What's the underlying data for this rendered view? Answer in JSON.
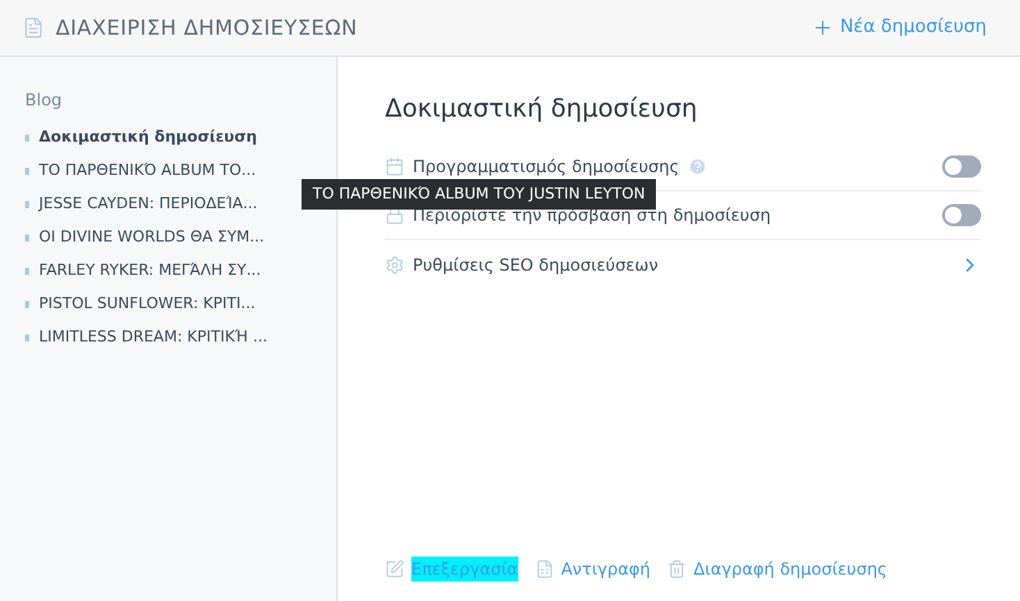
{
  "header": {
    "title": "ΔΙΑΧΕΙΡΙΣΗ ΔΗΜΟΣΙΕΥΣΕΩΝ",
    "new_button": "Νέα δημοσίευση"
  },
  "sidebar": {
    "heading": "Blog",
    "items": [
      {
        "label": "Δοκιμαστική δημοσίευση",
        "selected": true
      },
      {
        "label": "ΤΟ ΠΑΡΘΕΝΙΚΌ ALBUM ΤΟ...",
        "selected": false
      },
      {
        "label": "JESSE CAYDEN: ΠΕΡΙΟΔΕΊΑ...",
        "selected": false
      },
      {
        "label": "OI DIVINE WORLDS ΘΑ ΣΥΜ...",
        "selected": false
      },
      {
        "label": "FARLEY RYKER: ΜΕΓΆΛΗ ΣΥ...",
        "selected": false
      },
      {
        "label": "PISTOL SUNFLOWER: ΚΡΙΤΙ...",
        "selected": false
      },
      {
        "label": "LIMITLESS DREAM: ΚΡΙΤΙΚΉ ...",
        "selected": false
      }
    ]
  },
  "tooltip": "ΤΟ ΠΑΡΘΕΝΙΚΌ ALBUM ΤΟΥ JUSTIN LEYTON",
  "main": {
    "title": "Δοκιμαστική δημοσίευση",
    "settings": [
      {
        "kind": "toggle",
        "label": "Προγραμματισμός δημοσίευσης",
        "help": true,
        "on": false
      },
      {
        "kind": "toggle",
        "label": "Περιορίστε την πρόσβαση στη δημοσίευση",
        "help": false,
        "on": false
      },
      {
        "kind": "link",
        "label": "Ρυθμίσεις SEO δημοσιεύσεων"
      }
    ],
    "actions": [
      {
        "label": "Επεξεργασία",
        "highlighted": true
      },
      {
        "label": "Αντιγραφή",
        "highlighted": false
      },
      {
        "label": "Διαγραφή δημοσίευσης",
        "highlighted": false
      }
    ]
  }
}
